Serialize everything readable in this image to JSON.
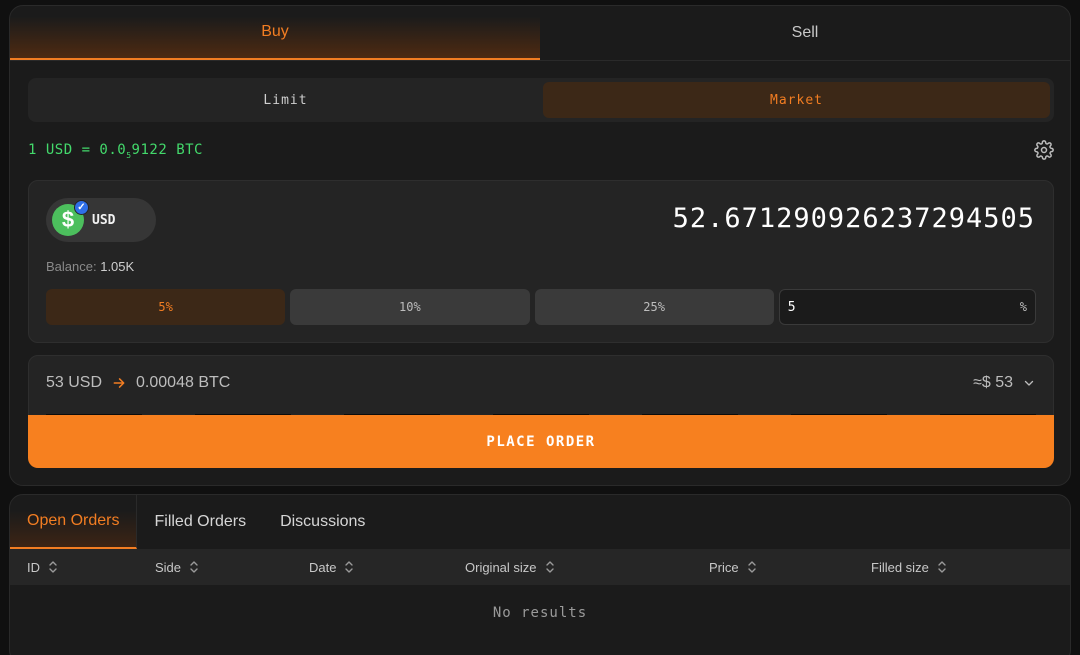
{
  "trade": {
    "side_tabs": [
      {
        "label": "Buy",
        "active": true
      },
      {
        "label": "Sell",
        "active": false
      }
    ],
    "order_types": [
      {
        "label": "Limit",
        "active": false
      },
      {
        "label": "Market",
        "active": true
      }
    ],
    "rate": {
      "prefix": "1 USD = 0.0",
      "subscript": "5",
      "suffix": "9122 BTC"
    },
    "amount": {
      "token_symbol": "USD",
      "token_icon": "dollar-icon",
      "value": "52.671290926237294505",
      "balance_label": "Balance:",
      "balance_value": "1.05K"
    },
    "percent_buttons": [
      {
        "label": "5%",
        "active": true
      },
      {
        "label": "10%",
        "active": false
      },
      {
        "label": "25%",
        "active": false
      }
    ],
    "percent_input": {
      "value": "5",
      "unit": "%"
    },
    "summary": {
      "from": "53 USD",
      "to": "0.00048 BTC",
      "usd_estimate": "≈$ 53"
    },
    "place_order_label": "PLACE ORDER"
  },
  "orders": {
    "tabs": [
      {
        "label": "Open Orders",
        "active": true
      },
      {
        "label": "Filled Orders",
        "active": false
      },
      {
        "label": "Discussions",
        "active": false
      }
    ],
    "columns": [
      "ID",
      "Side",
      "Date",
      "Original size",
      "Price",
      "Filled size"
    ],
    "empty_text": "No results"
  },
  "colors": {
    "accent": "#f27d22",
    "button": "#f7801f",
    "rate_text": "#43d96b",
    "background": "#101010",
    "card": "#1b1b1b"
  }
}
